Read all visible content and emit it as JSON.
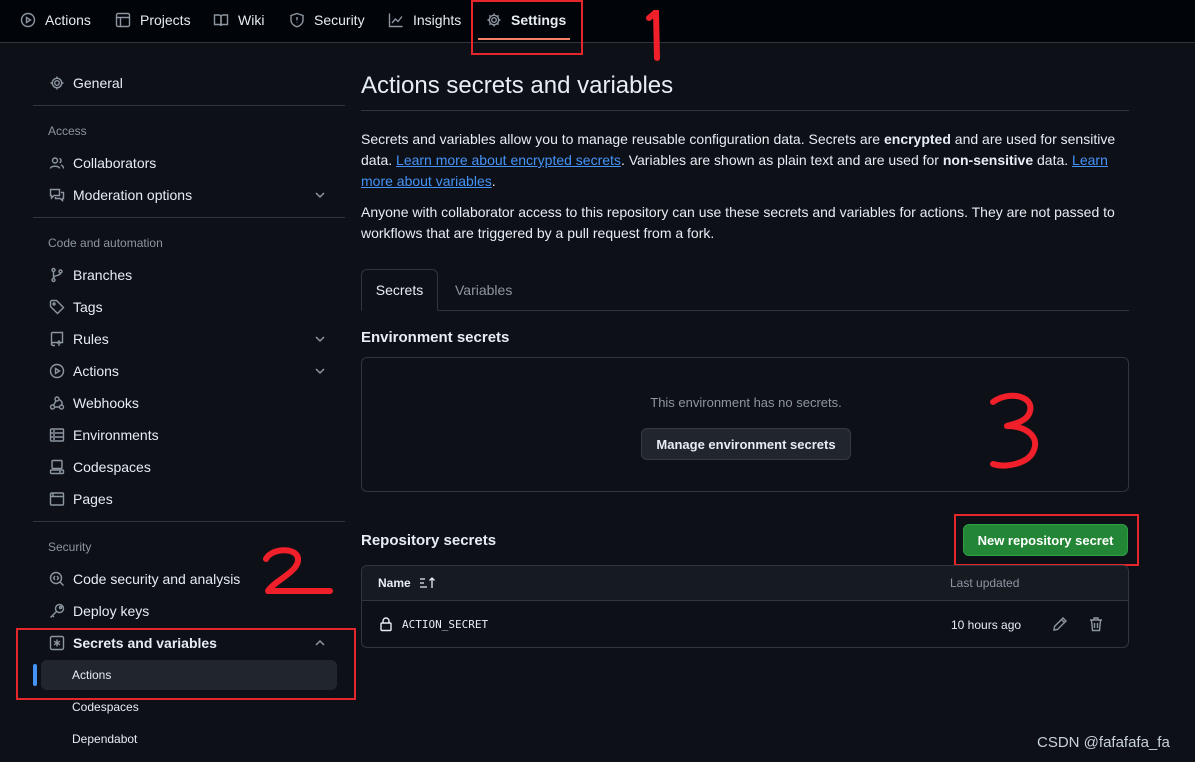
{
  "topnav": {
    "items": [
      {
        "label": "Actions",
        "icon": "play-icon"
      },
      {
        "label": "Projects",
        "icon": "table-icon"
      },
      {
        "label": "Wiki",
        "icon": "book-icon"
      },
      {
        "label": "Security",
        "icon": "shield-icon"
      },
      {
        "label": "Insights",
        "icon": "graph-icon"
      },
      {
        "label": "Settings",
        "icon": "gear-icon",
        "selected": true
      }
    ]
  },
  "annotations": {
    "one": "1",
    "two": "2",
    "three": "3"
  },
  "sidebar": {
    "general": "General",
    "access_heading": "Access",
    "collaborators": "Collaborators",
    "moderation": "Moderation options",
    "code_heading": "Code and automation",
    "branches": "Branches",
    "tags": "Tags",
    "rules": "Rules",
    "actions": "Actions",
    "webhooks": "Webhooks",
    "environments": "Environments",
    "codespaces": "Codespaces",
    "pages": "Pages",
    "security_heading": "Security",
    "code_security": "Code security and analysis",
    "deploy_keys": "Deploy keys",
    "secrets_vars": "Secrets and variables",
    "sub_actions": "Actions",
    "sub_codespaces": "Codespaces",
    "sub_dependabot": "Dependabot"
  },
  "main": {
    "title": "Actions secrets and variables",
    "p1_a": "Secrets and variables allow you to manage reusable configuration data. Secrets are ",
    "p1_b": "encrypted",
    "p1_c": " and are used for sensitive data. ",
    "p1_link1": "Learn more about encrypted secrets",
    "p1_d": ". Variables are shown as plain text and are used for ",
    "p1_e": "non-sensitive",
    "p1_f": " data. ",
    "p1_link2": "Learn more about variables",
    "p1_g": ".",
    "p2": "Anyone with collaborator access to this repository can use these secrets and variables for actions. They are not passed to workflows that are triggered by a pull request from a fork.",
    "tab_secrets": "Secrets",
    "tab_variables": "Variables",
    "env_heading": "Environment secrets",
    "env_empty": "This environment has no secrets.",
    "env_button": "Manage environment secrets",
    "repo_heading": "Repository secrets",
    "new_button": "New repository secret",
    "col_name": "Name",
    "col_updated": "Last updated",
    "rows": [
      {
        "name": "ACTION_SECRET",
        "updated": "10 hours ago"
      }
    ]
  },
  "watermark": "CSDN @fafafafa_fa"
}
